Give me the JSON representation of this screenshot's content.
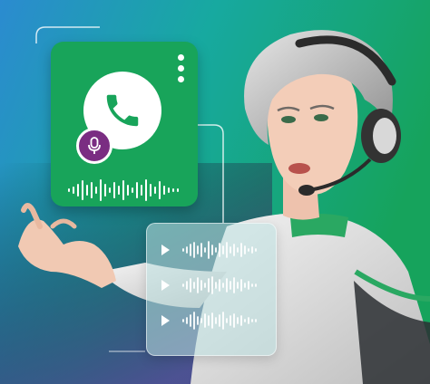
{
  "colors": {
    "background_left": "#2a86c9",
    "background_right": "#1aa85f",
    "card_green": "#18a45a",
    "mic_badge": "#7a2d82",
    "voice_card": "#bfe3e3"
  },
  "call_card": {
    "main_icon": "phone-icon",
    "badge_icon": "microphone-icon",
    "menu_icon": "kebab-menu-icon",
    "waveform_icon": "audio-waveform-icon"
  },
  "voice_messages": {
    "rows": [
      {
        "icon": "play-icon"
      },
      {
        "icon": "play-icon"
      },
      {
        "icon": "play-icon"
      }
    ]
  },
  "person": {
    "description_icon": "support-agent-with-headset"
  }
}
